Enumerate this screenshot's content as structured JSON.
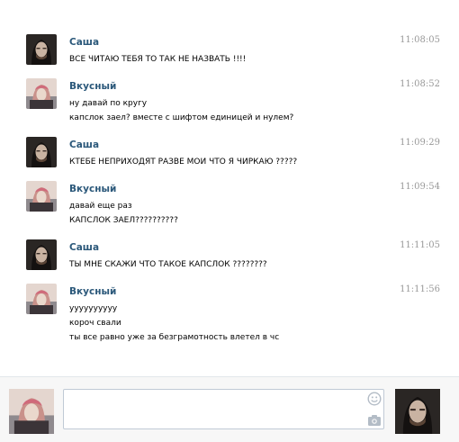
{
  "messages": [
    {
      "author": "Саша",
      "time": "11:08:05",
      "avatar": "sasha-avatar",
      "lines": [
        "ВСЕ ЧИТАЮ ТЕБЯ ТО ТАК НЕ НАЗВАТЬ !!!!"
      ]
    },
    {
      "author": "Вкусный",
      "time": "11:08:52",
      "avatar": "vkusny-avatar",
      "lines": [
        "ну давай по кругу",
        "капслок заел? вместе с шифтом единицей и нулем?"
      ]
    },
    {
      "author": "Саша",
      "time": "11:09:29",
      "avatar": "sasha-avatar",
      "lines": [
        "КТЕБЕ НЕПРИХОДЯТ РАЗВЕ МОИ ЧТО Я ЧИРКАЮ ?????"
      ]
    },
    {
      "author": "Вкусный",
      "time": "11:09:54",
      "avatar": "vkusny-avatar",
      "lines": [
        "давай еще раз",
        "КАПСЛОК ЗАЕЛ??????????"
      ]
    },
    {
      "author": "Саша",
      "time": "11:11:05",
      "avatar": "sasha-avatar",
      "lines": [
        "ТЫ МНЕ СКАЖИ ЧТО ТАКОЕ КАПСЛОК ????????"
      ]
    },
    {
      "author": "Вкусный",
      "time": "11:11:56",
      "avatar": "vkusny-avatar",
      "lines": [
        "уууууууууу",
        "короч свали",
        "ты все равно уже за безграмотность влетел в чс"
      ]
    }
  ],
  "composer": {
    "input_value": "",
    "emoji_icon": "smiley-icon",
    "attach_icon": "camera-icon"
  },
  "colors": {
    "author": "#2b587a",
    "time": "#999999",
    "text": "#000000",
    "composer_bg": "#f7f7f7",
    "input_border": "#c0cad5"
  }
}
